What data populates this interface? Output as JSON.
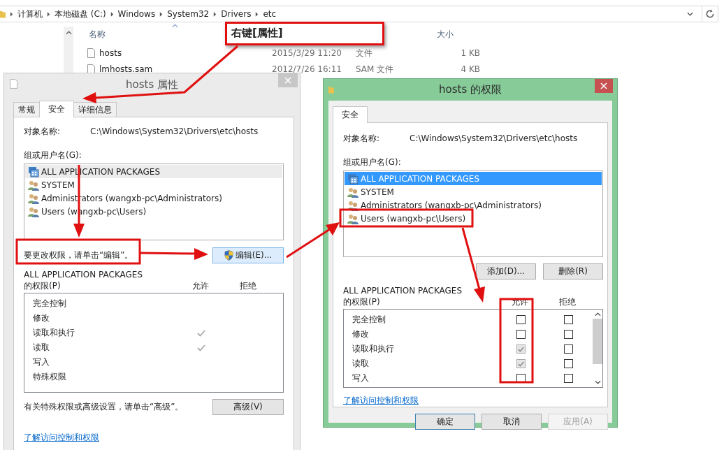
{
  "explorer": {
    "breadcrumb": [
      "计算机",
      "本地磁盘 (C:)",
      "Windows",
      "System32",
      "Drivers",
      "etc"
    ],
    "columns": [
      "名称",
      "大小"
    ],
    "files": [
      {
        "name": "hosts",
        "date": "2015/3/29 11:20",
        "type": "文件",
        "size": "1 KB"
      },
      {
        "name": "lmhosts.sam",
        "date": "2012/7/26 16:11",
        "type": "SAM 文件",
        "size": "4 KB"
      }
    ]
  },
  "callout": "右键[属性]",
  "properties_dialog": {
    "title": "hosts 属性",
    "tabs": [
      {
        "label": "常规",
        "selected": false
      },
      {
        "label": "安全",
        "selected": true
      },
      {
        "label": "详细信息",
        "selected": false
      }
    ],
    "object_label": "对象名称:",
    "object_path": "C:\\Windows\\System32\\Drivers\\etc\\hosts",
    "groups_label": "组或用户名(G):",
    "groups": [
      {
        "name": "ALL APPLICATION PACKAGES",
        "kind": "package",
        "selected": true
      },
      {
        "name": "SYSTEM",
        "kind": "users",
        "selected": false
      },
      {
        "name": "Administrators (wangxb-pc\\Administrators)",
        "kind": "users",
        "selected": false
      },
      {
        "name": "Users (wangxb-pc\\Users)",
        "kind": "users",
        "selected": false
      }
    ],
    "edit_hint": "要更改权限，请单击“编辑”。",
    "edit_button": "编辑(E)...",
    "permissions_title": "ALL APPLICATION PACKAGES",
    "permissions_label": "的权限(P)",
    "allow_header": "允许",
    "deny_header": "拒绝",
    "permissions": [
      {
        "name": "完全控制",
        "allow": false,
        "deny": false
      },
      {
        "name": "修改",
        "allow": false,
        "deny": false
      },
      {
        "name": "读取和执行",
        "allow": true,
        "deny": false
      },
      {
        "name": "读取",
        "allow": true,
        "deny": false
      },
      {
        "name": "写入",
        "allow": false,
        "deny": false
      },
      {
        "name": "特殊权限",
        "allow": false,
        "deny": false
      }
    ],
    "advanced_hint": "有关特殊权限或高级设置，请单击“高级”。",
    "advanced_button": "高级(V)",
    "help_link": "了解访问控制和权限"
  },
  "permissions_dialog": {
    "title": "hosts 的权限",
    "tabs": [
      {
        "label": "安全",
        "selected": true
      }
    ],
    "object_label": "对象名称:",
    "object_path": "C:\\Windows\\System32\\Drivers\\etc\\hosts",
    "groups_label": "组或用户名(G):",
    "groups": [
      {
        "name": "ALL APPLICATION PACKAGES",
        "kind": "package",
        "selected": true
      },
      {
        "name": "SYSTEM",
        "kind": "users",
        "selected": false
      },
      {
        "name": "Administrators (wangxb-pc\\Administrators)",
        "kind": "users",
        "selected": false
      },
      {
        "name": "Users (wangxb-pc\\Users)",
        "kind": "users",
        "selected": false
      }
    ],
    "add_button": "添加(D)...",
    "remove_button": "删除(R)",
    "permissions_title": "ALL APPLICATION PACKAGES",
    "permissions_label": "的权限(P)",
    "allow_header": "允许",
    "deny_header": "拒绝",
    "permissions": [
      {
        "name": "完全控制",
        "allow": false,
        "deny": false
      },
      {
        "name": "修改",
        "allow": false,
        "deny": false
      },
      {
        "name": "读取和执行",
        "allow": true,
        "deny": false
      },
      {
        "name": "读取",
        "allow": true,
        "deny": false
      },
      {
        "name": "写入",
        "allow": false,
        "deny": false
      }
    ],
    "help_link": "了解访问控制和权限",
    "buttons": [
      {
        "label": "确定",
        "kind": "default",
        "disabled": false
      },
      {
        "label": "取消",
        "kind": "normal",
        "disabled": false
      },
      {
        "label": "应用(A)",
        "kind": "normal",
        "disabled": true
      }
    ]
  }
}
